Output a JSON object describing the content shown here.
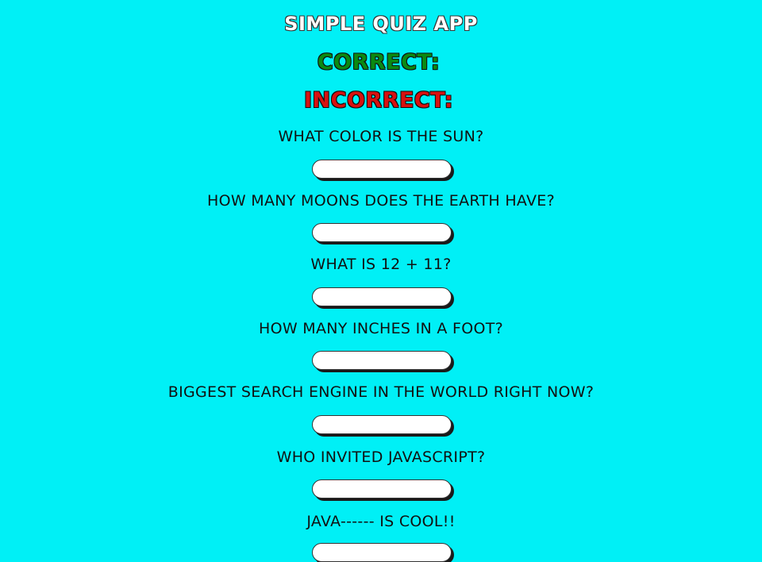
{
  "app": {
    "title": "SIMPLE QUIZ APP"
  },
  "score": {
    "correct_label": "CORRECT:",
    "correct_count": "",
    "incorrect_label": "INCORRECT:",
    "incorrect_count": ""
  },
  "questions": [
    {
      "text": "WHAT COLOR IS THE SUN?",
      "answer": ""
    },
    {
      "text": "HOW MANY MOONS DOES THE EARTH HAVE?",
      "answer": ""
    },
    {
      "text": "WHAT IS 12 + 11?",
      "answer": ""
    },
    {
      "text": "HOW MANY INCHES IN A FOOT?",
      "answer": ""
    },
    {
      "text": "BIGGEST SEARCH ENGINE IN THE WORLD RIGHT NOW?",
      "answer": ""
    },
    {
      "text": "WHO INVITED JAVASCRIPT?",
      "answer": ""
    },
    {
      "text": "JAVA------ IS COOL!!",
      "answer": ""
    }
  ],
  "colors": {
    "background": "#00f0f6",
    "correct": "#0a8a12",
    "incorrect": "#d81010"
  }
}
